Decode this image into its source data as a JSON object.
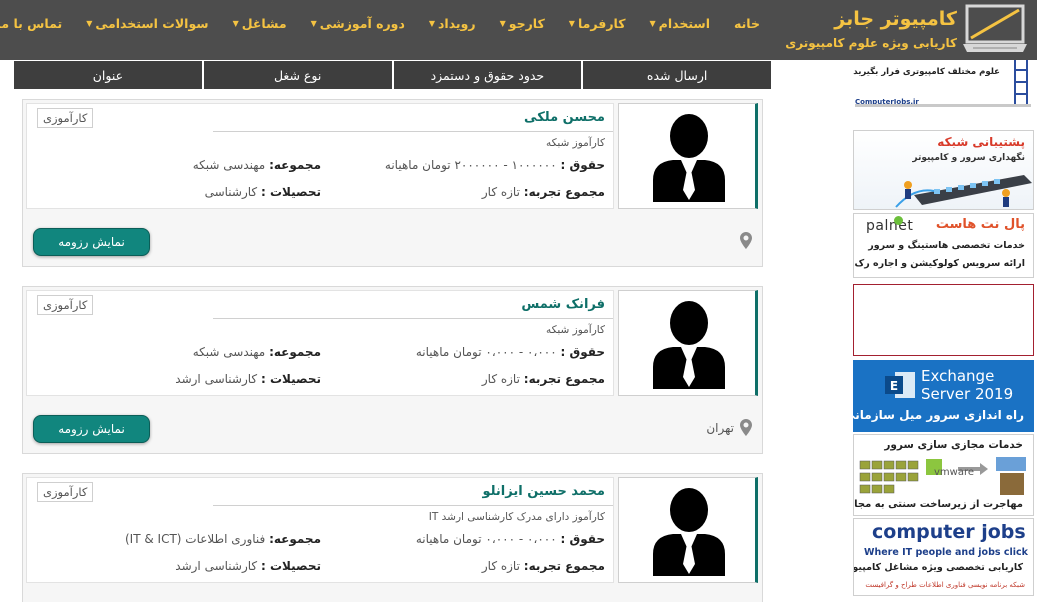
{
  "header": {
    "logo_title": "کامپیوتر جابز",
    "logo_subtitle": "کاریابی ویژه علوم کامپیوتری",
    "nav": [
      {
        "label": "خانه",
        "dropdown": false
      },
      {
        "label": "استخدام",
        "dropdown": true
      },
      {
        "label": "کارفرما",
        "dropdown": true
      },
      {
        "label": "کارجو",
        "dropdown": true
      },
      {
        "label": "رویداد",
        "dropdown": true
      },
      {
        "label": "دوره آموزشی",
        "dropdown": true
      },
      {
        "label": "مشاغل",
        "dropdown": true
      },
      {
        "label": "سوالات استخدامی",
        "dropdown": true
      },
      {
        "label": "تماس با ما",
        "dropdown": true
      }
    ],
    "colors": {
      "background": "#4d4d4d",
      "accent": "#f5c342"
    }
  },
  "tabs": [
    "ارسال شده",
    "حدود حقوق و دستمزد",
    "نوع شغل",
    "عنوان"
  ],
  "labels": {
    "salary": "حقوق :",
    "group": "مجموعه:",
    "experience": "مجموع تجربه:",
    "education": "تحصیلات :",
    "resume_button": "نمایش رزومه"
  },
  "candidates": [
    {
      "name": "محسن ملکی",
      "subtitle": "کارآموز شبکه",
      "badge": "کارآموزی",
      "salary": "۱۰۰۰۰۰۰ - ۲۰۰۰۰۰۰ تومان ماهیانه",
      "group": "مهندسی شبکه",
      "experience": "تازه کار",
      "education": "کارشناسی",
      "location": ""
    },
    {
      "name": "فرانک شمس",
      "subtitle": "کارآموز شبکه",
      "badge": "کارآموزی",
      "salary": "۰،۰۰۰ - ۰،۰۰۰ تومان ماهیانه",
      "group": "مهندسی شبکه",
      "experience": "تازه کار",
      "education": "کارشناسی ارشد",
      "location": "تهران"
    },
    {
      "name": "محمد حسین ایزانلو",
      "subtitle": "کارآموز دارای مدرک کارشناسی ارشد IT",
      "badge": "کارآموزی",
      "salary": "۰،۰۰۰ - ۰،۰۰۰ تومان ماهیانه",
      "group": "فناوری اطلاعات (IT & ICT)",
      "experience": "تازه کار",
      "education": "کارشناسی ارشد",
      "location": ""
    }
  ],
  "ads": {
    "top_banner": {
      "line1": "علوم مختلف کامپیوتری فرار بگیرید",
      "url_text": "ComputerJobs.ir"
    },
    "network_support": {
      "title": "پشتیبانی شبکه",
      "subtitle": "نگهداری سرور و کامپیوتر"
    },
    "palnet": {
      "brand": "palnet",
      "title": "پال نت هاست",
      "line1": "خدمات تخصصی هاستینگ و سرور",
      "line2": "ارائه سرویس کولوکیشن و اجاره رک"
    },
    "exchange": {
      "title1": "Exchange",
      "title2": "Server 2019",
      "subtitle": "راه اندازی سرور میل سازمانی"
    },
    "vmware": {
      "title": "خدمات مجازی سازی سرور",
      "brand": "vmware",
      "subtitle": "مهاجرت از زیرساخت سنتی به مجازی"
    },
    "computerjobs": {
      "brand": "computer jobs",
      "tagline": "Where IT people and jobs click",
      "subtitle": "کاریابی تخصصی ویژه مشاغل کامپیوتری",
      "footer": "شبکه  برنامه نویسی  فناوری اطلاعات  طراح و گرافیست"
    }
  }
}
